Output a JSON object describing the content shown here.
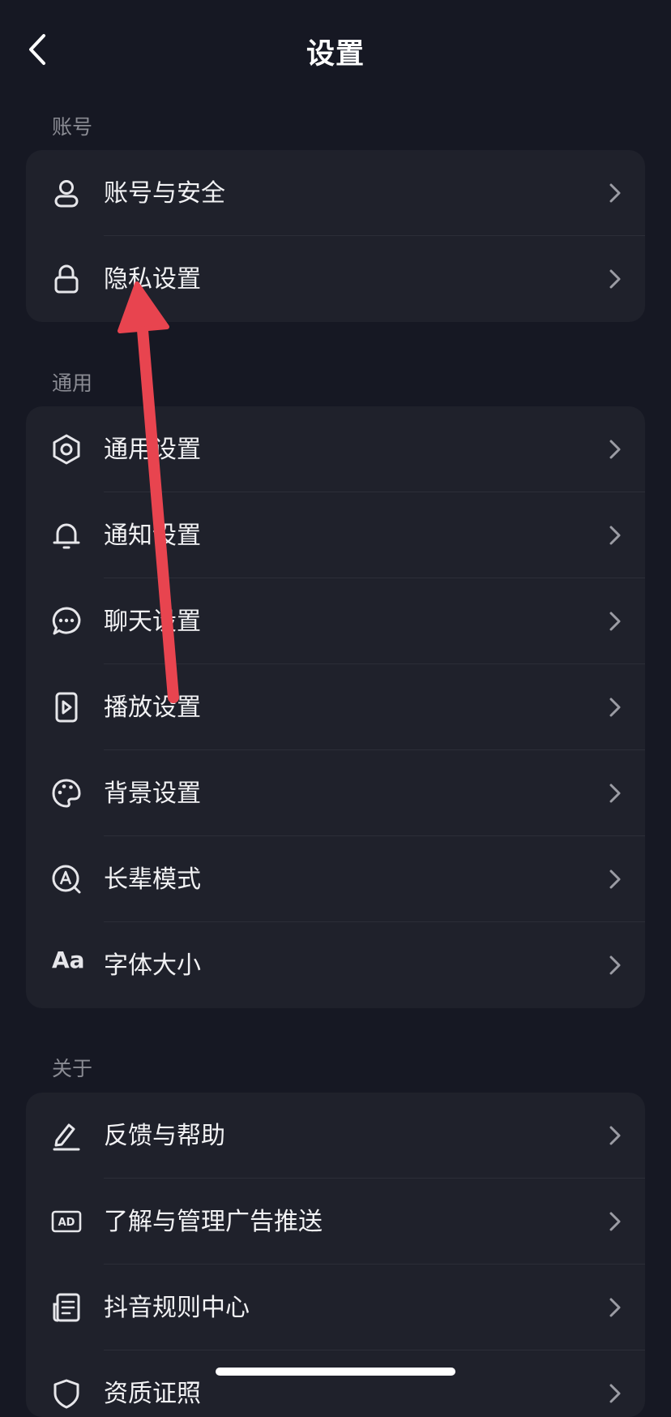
{
  "header": {
    "title": "设置"
  },
  "sections": [
    {
      "label": "账号",
      "items": [
        {
          "label": "账号与安全",
          "icon": "user-icon"
        },
        {
          "label": "隐私设置",
          "icon": "lock-icon"
        }
      ]
    },
    {
      "label": "通用",
      "items": [
        {
          "label": "通用设置",
          "icon": "gear-icon"
        },
        {
          "label": "通知设置",
          "icon": "bell-icon"
        },
        {
          "label": "聊天设置",
          "icon": "chat-bubble-icon"
        },
        {
          "label": "播放设置",
          "icon": "play-icon"
        },
        {
          "label": "背景设置",
          "icon": "palette-icon"
        },
        {
          "label": "长辈模式",
          "icon": "elder-mode-icon"
        },
        {
          "label": "字体大小",
          "icon": "font-size-icon",
          "icon_text": "Aa"
        }
      ]
    },
    {
      "label": "关于",
      "items": [
        {
          "label": "反馈与帮助",
          "icon": "edit-pen-icon"
        },
        {
          "label": "了解与管理广告推送",
          "icon": "ad-icon",
          "icon_text": "AD"
        },
        {
          "label": "抖音规则中心",
          "icon": "document-icon"
        },
        {
          "label": "资质证照",
          "icon": "shield-icon"
        }
      ]
    }
  ],
  "colors": {
    "background": "#161823",
    "card": "#1f212b",
    "section_label": "#8a8b93",
    "annotation_arrow": "#e8444f"
  }
}
